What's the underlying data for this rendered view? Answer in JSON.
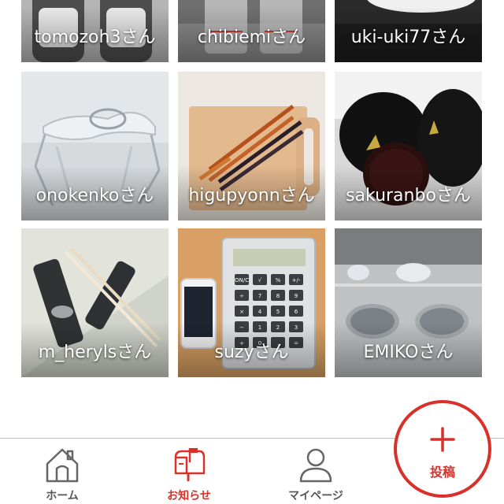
{
  "feed": {
    "tiles": [
      {
        "user": "tomozoh3さん"
      },
      {
        "user": "chibiemiさん"
      },
      {
        "user": "uki-uki77さん"
      },
      {
        "user": "onokenkoさん"
      },
      {
        "user": "higupyonnさん"
      },
      {
        "user": "sakuranboさん"
      },
      {
        "user": "m_herylsさん"
      },
      {
        "user": "suzyさん"
      },
      {
        "user": "EMIKOさん"
      }
    ]
  },
  "calculator": {
    "keys": [
      "ON/C",
      "√",
      "%",
      "+/-",
      "÷",
      "7",
      "8",
      "9",
      "×",
      "4",
      "5",
      "6",
      "−",
      "1",
      "2",
      "3",
      "+",
      "0",
      ".",
      "="
    ]
  },
  "tabbar": {
    "home_label": "ホーム",
    "notifications_label": "お知らせ",
    "mypage_label": "マイページ",
    "post_label": "投稿"
  },
  "colors": {
    "accent": "#d9302a",
    "tab_text": "#555555",
    "icon_gray": "#666666"
  }
}
